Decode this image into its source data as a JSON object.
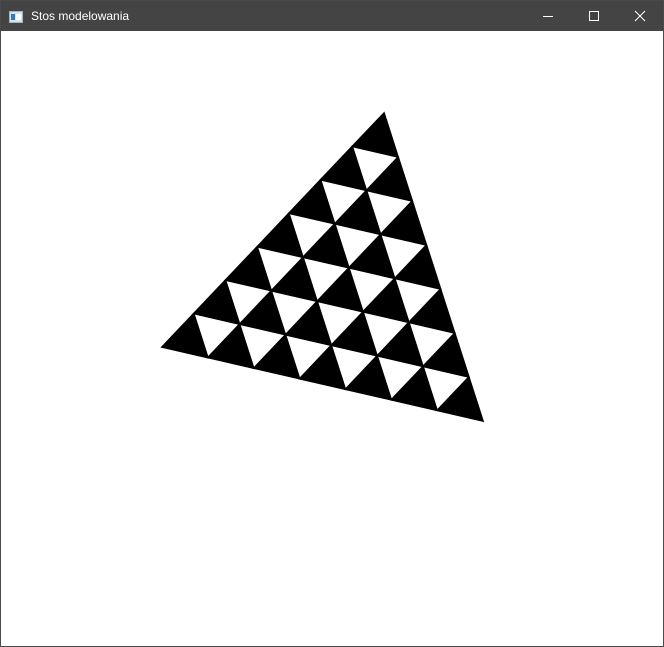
{
  "window": {
    "title": "Stos modelowania",
    "icons": {
      "app": "application-window-icon",
      "minimize": "minimize-icon",
      "maximize": "maximize-icon",
      "close": "close-icon"
    }
  },
  "canvas": {
    "background": "#ffffff",
    "shape_color": "#000000",
    "shape": "triangle-of-stacked-triangles",
    "rows": 7
  },
  "colors": {
    "titlebar": "#444444",
    "titlebar_text": "#ffffff",
    "border": "#4a4a4a"
  }
}
